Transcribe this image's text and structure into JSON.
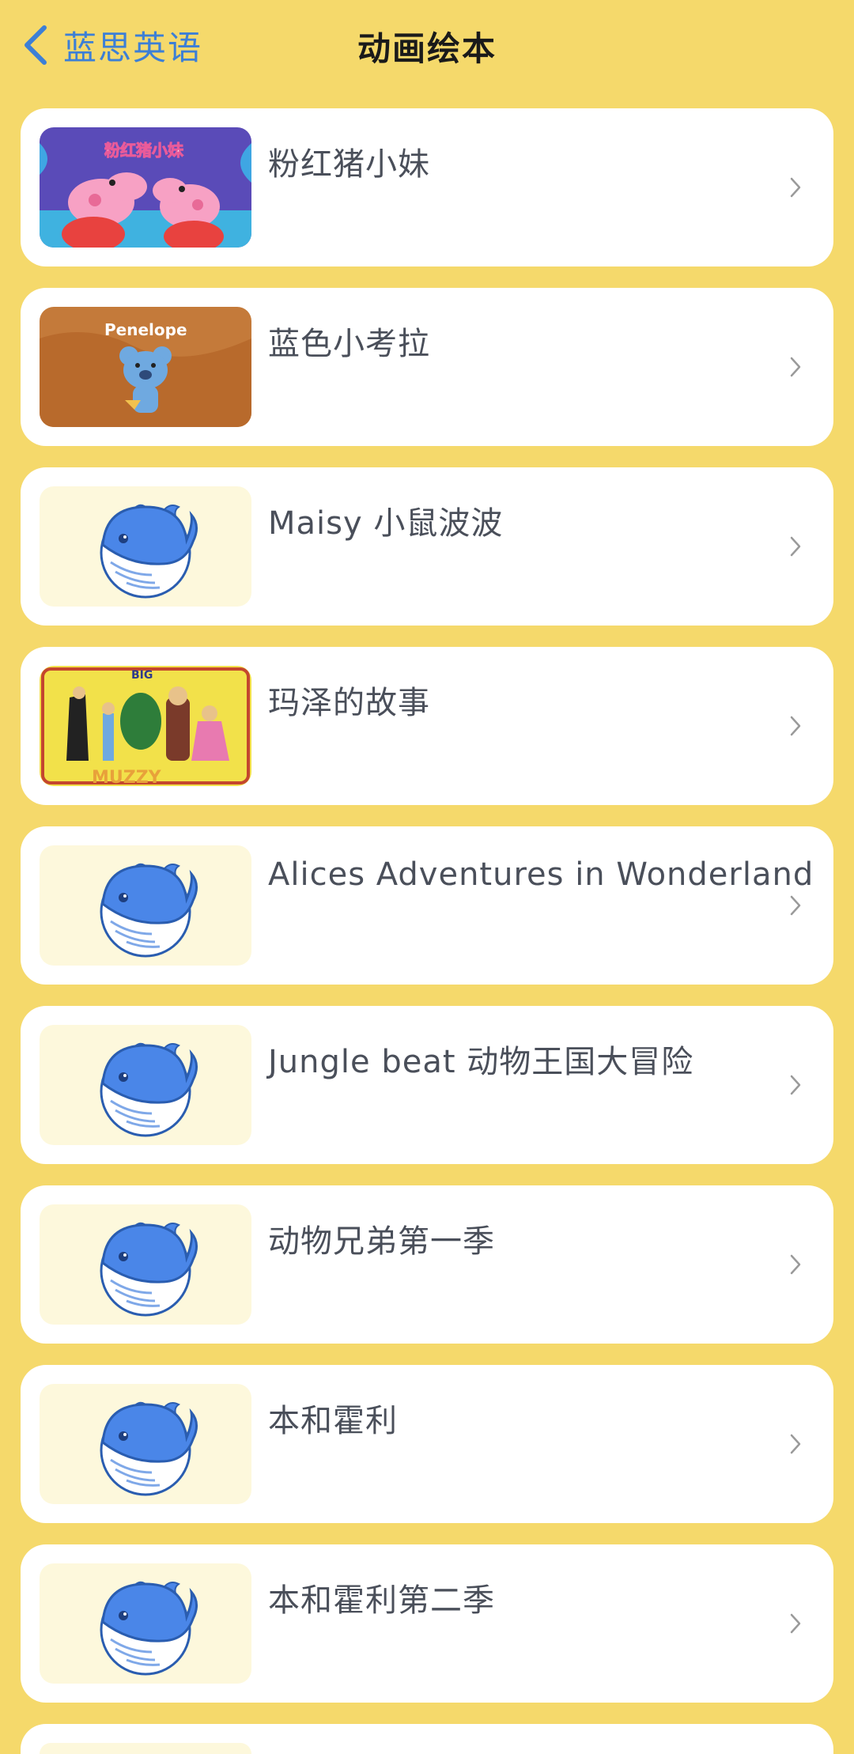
{
  "nav": {
    "back_label": "蓝思英语",
    "title": "动画绘本"
  },
  "items": [
    {
      "title": "粉红猪小妹",
      "thumb": "peppa-pig-cover",
      "thumb_text": "粉红猪小妹"
    },
    {
      "title": "蓝色小考拉",
      "thumb": "penelope-koala-cover",
      "thumb_text": "Penelope"
    },
    {
      "title": "Maisy 小鼠波波",
      "thumb": "whale-placeholder-icon"
    },
    {
      "title": "玛泽的故事",
      "thumb": "big-muzzy-cover",
      "thumb_text": "BIG",
      "thumb_text2": "MUZZY"
    },
    {
      "title": "Alices Adventures in Wonderland",
      "thumb": "whale-placeholder-icon"
    },
    {
      "title": "Jungle beat 动物王国大冒险",
      "thumb": "whale-placeholder-icon"
    },
    {
      "title": "动物兄弟第一季",
      "thumb": "whale-placeholder-icon"
    },
    {
      "title": "本和霍利",
      "thumb": "whale-placeholder-icon"
    },
    {
      "title": "本和霍利第二季",
      "thumb": "whale-placeholder-icon"
    }
  ],
  "colors": {
    "background": "#F5D96B",
    "card": "#FFFFFF",
    "accent": "#3C7FD6",
    "whale_blue": "#4A86E8"
  }
}
